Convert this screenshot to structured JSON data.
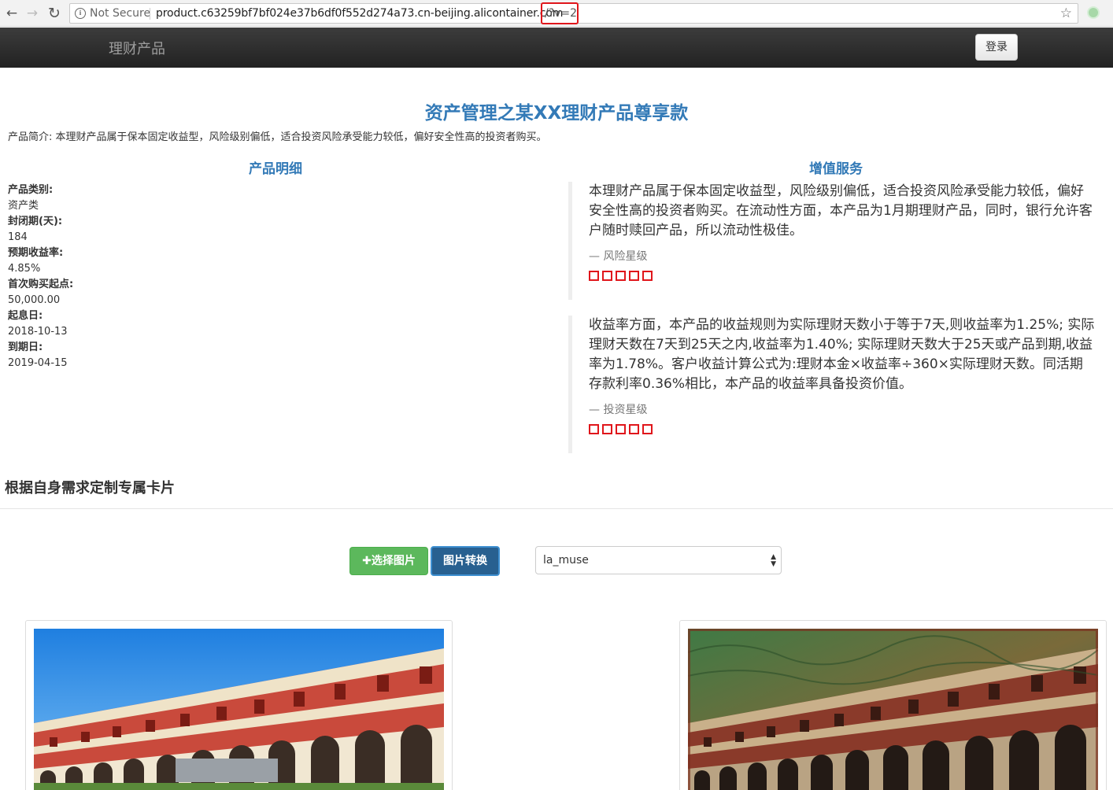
{
  "browser": {
    "security_label": "Not Secure",
    "url_base": "product.c63259bf7bf024e37b6df0f552d274a73.cn-beijing.alicontainer.com",
    "url_query": "/?v=2",
    "nav_back_icon": "back-arrow-icon",
    "nav_forward_icon": "forward-arrow-icon",
    "reload_icon": "reload-icon",
    "bookmark_icon": "star-icon",
    "highlight_color": "#e0161b"
  },
  "navbar": {
    "brand": "理财产品",
    "login_label": "登录"
  },
  "page": {
    "title": "资产管理之某XX理财产品尊享款",
    "intro": "产品简介: 本理财产品属于保本固定收益型，风险级别偏低，适合投资风险承受能力较低，偏好安全性高的投资者购买。",
    "details_heading": "产品明细",
    "services_heading": "增值服务",
    "details": [
      {
        "label": "产品类别:",
        "value": "资产类"
      },
      {
        "label": "封闭期(天):",
        "value": "184"
      },
      {
        "label": "预期收益率:",
        "value": "4.85%"
      },
      {
        "label": "首次购买起点:",
        "value": "50,000.00"
      },
      {
        "label": "起息日:",
        "value": "2018-10-13"
      },
      {
        "label": "到期日:",
        "value": "2019-04-15"
      }
    ],
    "services": [
      {
        "text": "本理财产品属于保本固定收益型，风险级别偏低，适合投资风险承受能力较低，偏好安全性高的投资者购买。在流动性方面，本产品为1月期理财产品，同时，银行允许客户随时赎回产品，所以流动性极佳。",
        "footer": "— 风险星级",
        "stars_total": 5,
        "stars_filled": 0
      },
      {
        "text": "收益率方面，本产品的收益规则为实际理财天数小于等于7天,则收益率为1.25%; 实际理财天数在7天到25天之内,收益率为1.40%; 实际理财天数大于25天或产品到期,收益率为1.78%。客户收益计算公式为:理财本金×收益率÷360×实际理财天数。同活期存款利率0.36%相比，本产品的收益率具备投资价值。",
        "footer": "— 投资星级",
        "stars_total": 5,
        "stars_filled": 0
      }
    ],
    "custom_heading": "根据自身需求定制专属卡片",
    "select_image_label": "✚选择图片",
    "convert_label": "图片转换",
    "style_selected": "la_muse",
    "accent": "#337ab7",
    "star_color": "#e0161b"
  }
}
